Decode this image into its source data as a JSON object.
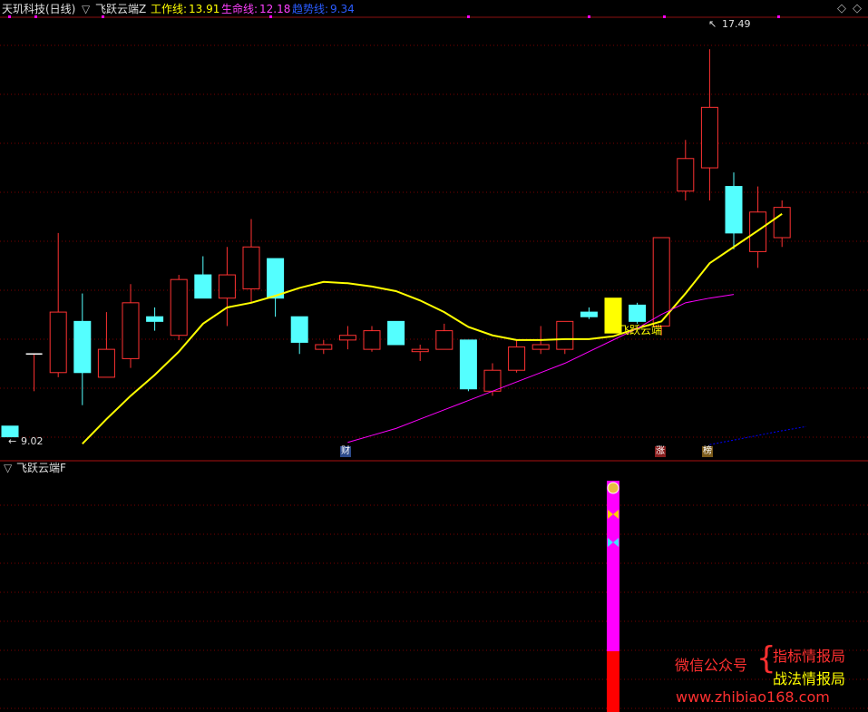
{
  "header": {
    "stock_name": "天玑科技(日线)",
    "indicator_name": "飞跃云端Z",
    "work_line_label": "工作线:",
    "work_line_value": "13.91",
    "life_line_label": "生命线:",
    "life_line_value": "12.18",
    "trend_line_label": "趋势线:",
    "trend_line_value": "9.34"
  },
  "sub_panel": {
    "title": "飞跃云端F"
  },
  "annotations": {
    "high_label": "17.49",
    "low_label": "9.02",
    "signal_label": "飞跃云端",
    "badge_cai": "财",
    "badge_zhang": "涨",
    "badge_bang": "榜"
  },
  "watermark": {
    "wechat": "微信公众号",
    "brace": "{",
    "line1": "指标情报局",
    "line2": "战法情报局",
    "url": "www.zhibiao168.com"
  },
  "colors": {
    "background": "#000000",
    "up": "#ff3232",
    "down": "#54ffff",
    "work_line": "#ffff00",
    "life_line": "#ff00ff",
    "trend_line": "#0000ff",
    "grid": "#7a0000",
    "signal_bar": "#ff00ff",
    "signal_bar_base": "#ff0000",
    "highlight_candle": "#ffff00"
  },
  "icons": [
    "money-bag-icon",
    "yellow-butterfly-icon",
    "cyan-butterfly-icon"
  ],
  "chart_data": {
    "type": "candlestick",
    "title": "天玑科技(日线)",
    "ylim": [
      8.8,
      18.0
    ],
    "grid": true,
    "candles": [
      {
        "o": 9.35,
        "h": 9.35,
        "l": 9.12,
        "c": 9.12
      },
      {
        "o": 10.9,
        "h": 10.9,
        "l": 10.1,
        "c": 10.9
      },
      {
        "o": 10.5,
        "h": 13.5,
        "l": 10.4,
        "c": 11.8
      },
      {
        "o": 11.6,
        "h": 12.2,
        "l": 9.8,
        "c": 10.5
      },
      {
        "o": 10.4,
        "h": 11.8,
        "l": 10.4,
        "c": 11.0
      },
      {
        "o": 10.8,
        "h": 12.4,
        "l": 10.6,
        "c": 12.0
      },
      {
        "o": 11.7,
        "h": 11.9,
        "l": 11.4,
        "c": 11.6
      },
      {
        "o": 11.3,
        "h": 12.6,
        "l": 11.2,
        "c": 12.5
      },
      {
        "o": 12.6,
        "h": 13.0,
        "l": 12.4,
        "c": 12.1
      },
      {
        "o": 12.1,
        "h": 13.2,
        "l": 11.5,
        "c": 12.6
      },
      {
        "o": 12.3,
        "h": 13.8,
        "l": 12.0,
        "c": 13.2
      },
      {
        "o": 12.95,
        "h": 12.95,
        "l": 11.7,
        "c": 12.1
      },
      {
        "o": 11.7,
        "h": 11.7,
        "l": 10.9,
        "c": 11.15
      },
      {
        "o": 11.0,
        "h": 11.2,
        "l": 10.9,
        "c": 11.1
      },
      {
        "o": 11.2,
        "h": 11.5,
        "l": 11.0,
        "c": 11.3
      },
      {
        "o": 11.0,
        "h": 11.5,
        "l": 10.95,
        "c": 11.4
      },
      {
        "o": 11.6,
        "h": 11.6,
        "l": 11.1,
        "c": 11.1
      },
      {
        "o": 10.95,
        "h": 11.1,
        "l": 10.75,
        "c": 11.0
      },
      {
        "o": 11.0,
        "h": 11.55,
        "l": 11.0,
        "c": 11.4
      },
      {
        "o": 11.2,
        "h": 11.2,
        "l": 10.1,
        "c": 10.15
      },
      {
        "o": 10.1,
        "h": 10.7,
        "l": 10.0,
        "c": 10.55
      },
      {
        "o": 10.55,
        "h": 11.2,
        "l": 10.5,
        "c": 11.05
      },
      {
        "o": 11.0,
        "h": 11.5,
        "l": 10.9,
        "c": 11.1
      },
      {
        "o": 11.0,
        "h": 11.6,
        "l": 10.9,
        "c": 11.6
      },
      {
        "o": 11.8,
        "h": 11.9,
        "l": 11.65,
        "c": 11.7
      },
      {
        "o": 11.35,
        "h": 12.1,
        "l": 11.35,
        "c": 12.1
      },
      {
        "o": 11.95,
        "h": 12.0,
        "l": 11.55,
        "c": 11.6
      },
      {
        "o": 11.5,
        "h": 13.4,
        "l": 11.3,
        "c": 13.4
      },
      {
        "o": 14.4,
        "h": 15.5,
        "l": 14.2,
        "c": 15.1
      },
      {
        "o": 14.9,
        "h": 17.45,
        "l": 14.2,
        "c": 16.2
      },
      {
        "o": 14.5,
        "h": 14.8,
        "l": 13.15,
        "c": 13.5
      },
      {
        "o": 13.1,
        "h": 14.5,
        "l": 12.75,
        "c": 13.95
      },
      {
        "o": 13.4,
        "h": 14.2,
        "l": 13.2,
        "c": 14.05
      }
    ],
    "series": [
      {
        "name": "工作线",
        "values": [
          8.97,
          9.5,
          10.0,
          10.45,
          10.95,
          11.55,
          11.9,
          12.0,
          12.15,
          12.32,
          12.45,
          12.42,
          12.35,
          12.25,
          12.05,
          11.8,
          11.48,
          11.3,
          11.2,
          11.2,
          11.22,
          11.22,
          11.28,
          11.45,
          11.6,
          12.2,
          12.85,
          13.2,
          13.55,
          13.91
        ]
      },
      {
        "name": "生命线",
        "values": [
          9.0,
          9.15,
          9.3,
          9.5,
          9.7,
          9.9,
          10.1,
          10.3,
          10.5,
          10.7,
          10.95,
          11.2,
          11.45,
          11.75,
          12.0,
          12.1,
          12.18
        ]
      },
      {
        "name": "趋势线",
        "values": [
          8.95,
          9.05,
          9.15,
          9.25,
          9.34
        ]
      }
    ],
    "signal": {
      "index": 25,
      "label": "飞跃云端"
    },
    "sub_panel": {
      "title": "飞跃云端F",
      "bar_index": 25
    }
  }
}
